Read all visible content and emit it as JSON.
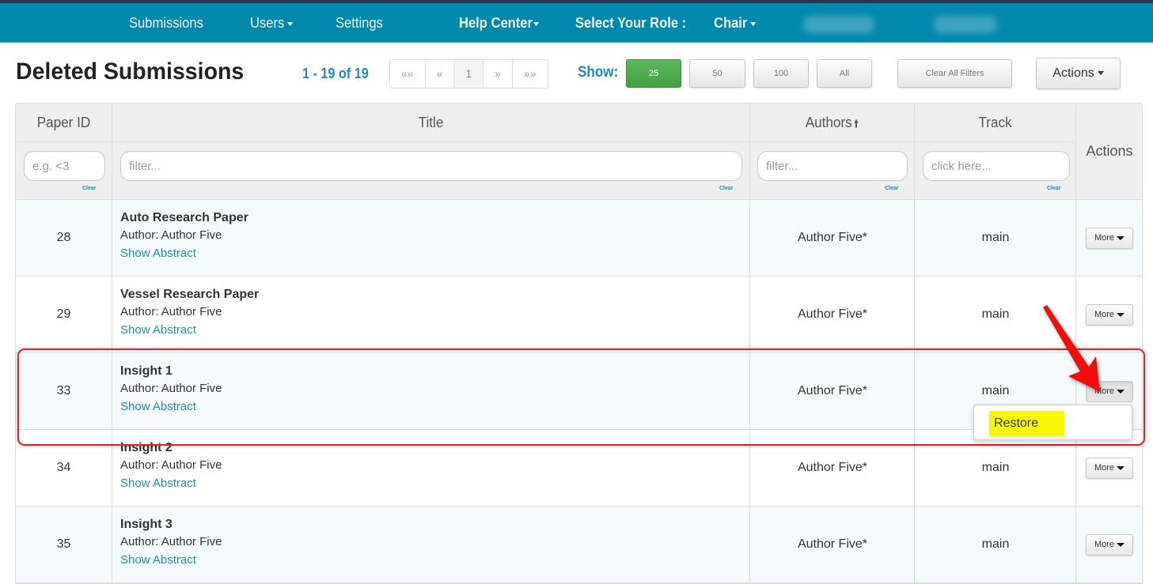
{
  "nav": {
    "items": [
      {
        "label": "Submissions"
      },
      {
        "label": "Users"
      },
      {
        "label": "Settings"
      },
      {
        "label": "Help Center"
      },
      {
        "label": "Select Your Role :"
      },
      {
        "label": "Chair"
      }
    ]
  },
  "page": {
    "title": "Deleted Submissions",
    "range": "1 - 19 of 19"
  },
  "pager": {
    "first": "««",
    "prev": "«",
    "current": "1",
    "next": "»",
    "last": "»»"
  },
  "show": {
    "label": "Show:",
    "options": [
      "25",
      "50",
      "100",
      "All"
    ],
    "selected": "25"
  },
  "toolbar": {
    "clear_all": "Clear All Filters",
    "actions": "Actions"
  },
  "table": {
    "headers": {
      "paper_id": "Paper ID",
      "title": "Title",
      "authors": "Authors",
      "track": "Track",
      "actions": "Actions"
    },
    "filters": {
      "paper_id_placeholder": "e.g. <3",
      "title_placeholder": "filter...",
      "authors_placeholder": "filter...",
      "track_placeholder": "click here...",
      "clear_label": "Clear"
    },
    "rows": [
      {
        "id": "28",
        "title": "Auto Research Paper",
        "author_label": "Author:",
        "author": "Author Five",
        "abstract_link": "Show Abstract",
        "authors": "Author Five*",
        "track": "main",
        "more": "More"
      },
      {
        "id": "29",
        "title": "Vessel Research Paper",
        "author_label": "Author:",
        "author": "Author Five",
        "abstract_link": "Show Abstract",
        "authors": "Author Five*",
        "track": "main",
        "more": "More"
      },
      {
        "id": "33",
        "title": "Insight 1",
        "author_label": "Author:",
        "author": "Author Five",
        "abstract_link": "Show Abstract",
        "authors": "Author Five*",
        "track": "main",
        "more": "More"
      },
      {
        "id": "34",
        "title": "Insight 2",
        "author_label": "Author:",
        "author": "Author Five",
        "abstract_link": "Show Abstract",
        "authors": "Author Five*",
        "track": "main",
        "more": "More"
      },
      {
        "id": "35",
        "title": "Insight 3",
        "author_label": "Author:",
        "author": "Author Five",
        "abstract_link": "Show Abstract",
        "authors": "Author Five*",
        "track": "main",
        "more": "More"
      }
    ]
  },
  "dropdown": {
    "items": [
      {
        "label": "Restore"
      }
    ]
  },
  "colors": {
    "navbar": "#0389ad",
    "accent": "#1d8bb5",
    "selected_green": "#5cb85c",
    "annotation_red": "#ee1c24",
    "highlight_yellow": "#f7f703"
  }
}
